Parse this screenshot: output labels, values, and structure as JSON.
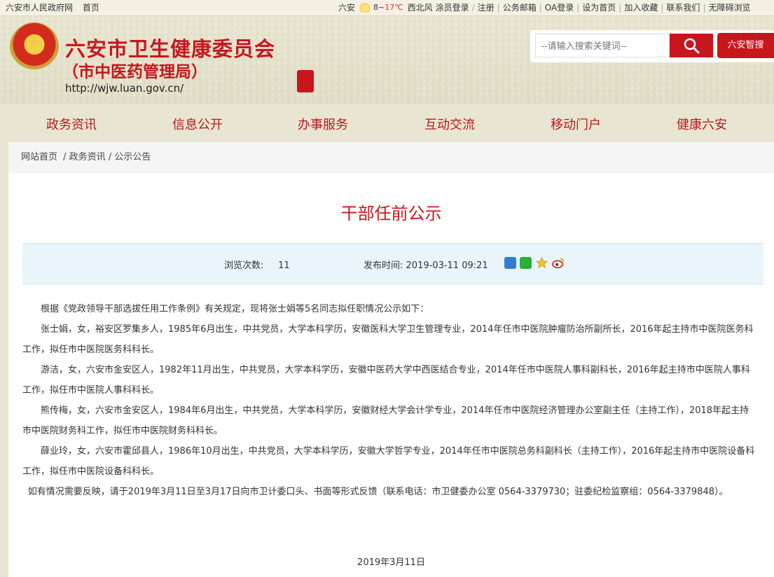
{
  "topbar": {
    "left_links": [
      "六安市人民政府网",
      "首页"
    ],
    "city": "六安",
    "weather_icon": "sun-cloud-icon",
    "temp_low": "8",
    "temp_high": "17℃",
    "wind": "西北风",
    "right_links": [
      "涂员登录",
      "注册",
      "公务邮箱",
      "OA登录",
      "设为首页",
      "加入收藏",
      "联系我们",
      "无障碍浏览"
    ]
  },
  "header": {
    "emblem_icon": "national-emblem-icon",
    "org_name": "六安市卫生健康委员会",
    "org_sub": "（市中医药管理局）",
    "url": "http://wjw.luan.gov.cn/",
    "seal_icon": "red-seal-icon"
  },
  "search": {
    "placeholder": "--请输入搜索关键词--",
    "button_icon": "search-icon",
    "smart_button": "六安智搜"
  },
  "nav": [
    "政务资讯",
    "信息公开",
    "办事服务",
    "互动交流",
    "移动门户",
    "健康六安"
  ],
  "breadcrumb": [
    "网站首页",
    "政务资讯",
    "公示公告"
  ],
  "article": {
    "title": "干部任前公示",
    "views_label": "浏览次数:",
    "views": "11",
    "publish_label": "发布时间:",
    "publish_time": "2019-03-11 09:21",
    "share_icons": [
      "plus-share-icon",
      "wechat-icon",
      "star-icon",
      "weibo-icon"
    ],
    "paragraphs": [
      "根据《党政领导干部选拔任用工作条例》有关规定，现将张士娟等5名同志拟任职情况公示如下：",
      "张士娟，女，裕安区罗集乡人，1985年6月出生，中共党员，大学本科学历，安徽医科大学卫生管理专业，2014年任市中医院肿瘤防治所副所长，2016年起主持市中医院医务科工作，拟任市中医院医务科科长。",
      "游洁，女，六安市金安区人，1982年11月出生，中共党员，大学本科学历，安徽中医药大学中西医结合专业，2014年任市中医院人事科副科长，2016年起主持市中医院人事科工作，拟任市中医院人事科科长。",
      "熊传梅，女，六安市金安区人，1984年6月出生，中共党员，大学本科学历，安徽财经大学会计学专业，2014年任市中医院经济管理办公室副主任（主持工作），2018年起主持市中医院财务科工作，拟任市中医院财务科科长。",
      "薛业玲，女，六安市霍邱县人，1986年10月出生，中共党员，大学本科学历，安徽大学哲学专业，2014年任市中医院总务科副科长（主持工作），2016年起主持市中医院设备科工作，拟任市中医院设备科科长。",
      "如有情况需要反映，请于2019年3月11日至3月17日向市卫计委口头、书面等形式反馈（联系电话：市卫健委办公室 0564-3379730；驻委纪检监察组：0564-3379848）。"
    ],
    "sign_date": "2019年3月11日"
  }
}
